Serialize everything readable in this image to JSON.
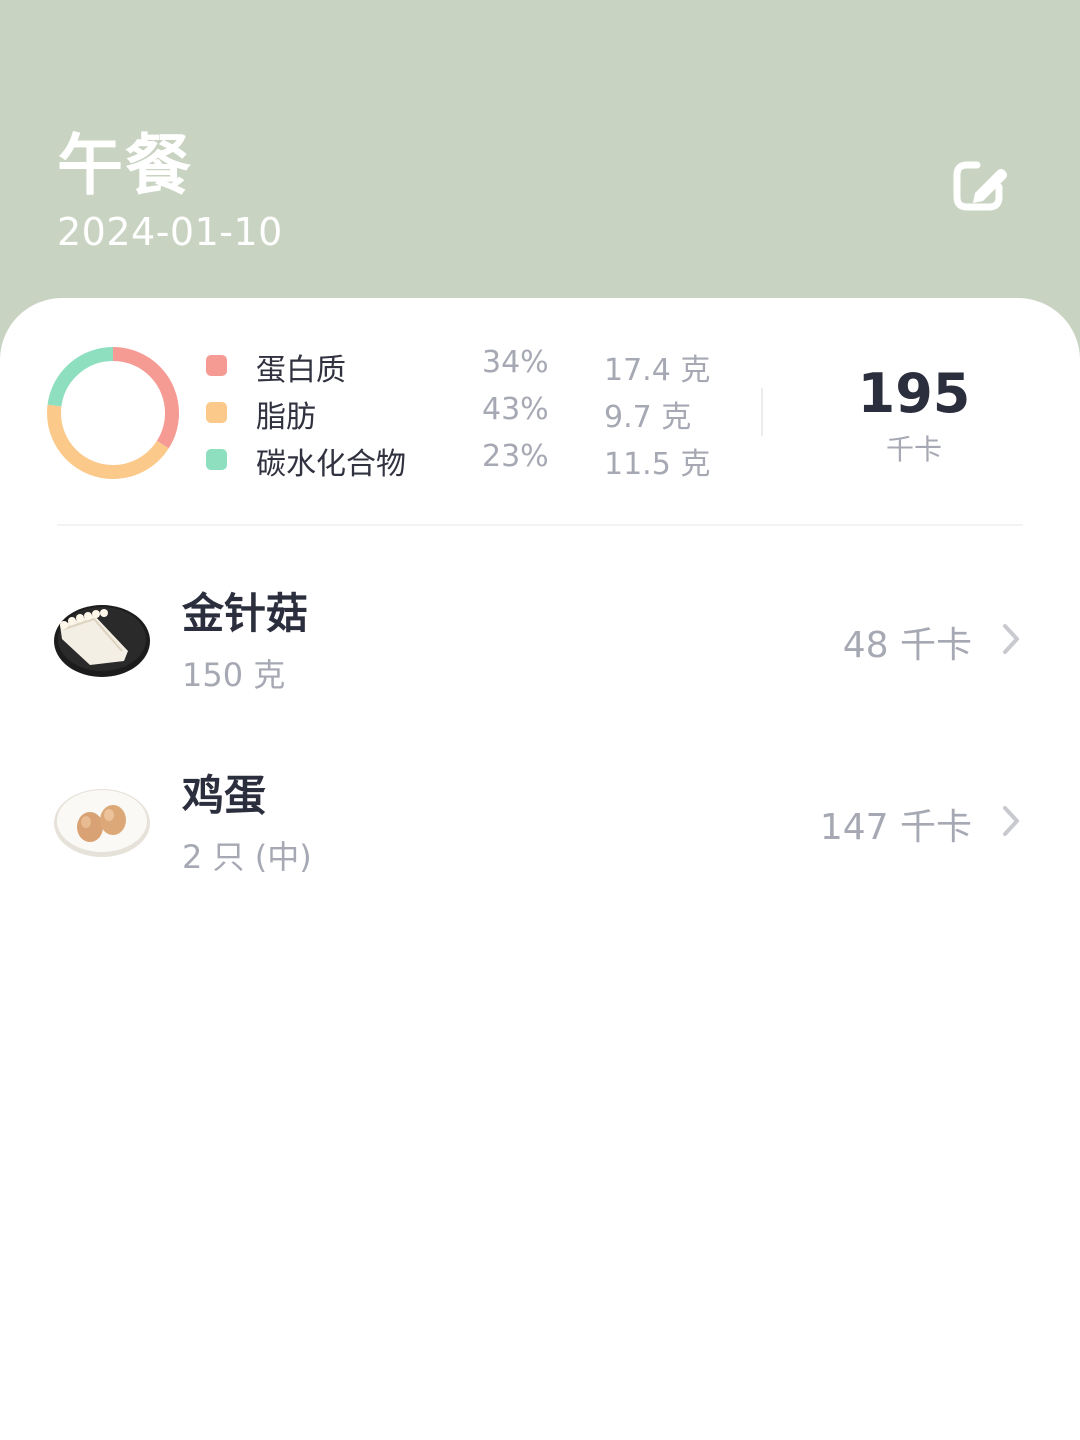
{
  "header": {
    "title": "午餐",
    "date": "2024-01-10",
    "edit_icon": "edit-icon",
    "background_color": "#c9d3c2"
  },
  "summary": {
    "macros": [
      {
        "name": "蛋白质",
        "percent": "34%",
        "amount": "17.4 克",
        "color": "#f59b93",
        "fraction": 0.34
      },
      {
        "name": "脂肪",
        "percent": "43%",
        "amount": "9.7 克",
        "color": "#fbc98a",
        "fraction": 0.43
      },
      {
        "name": "碳水化合物",
        "percent": "23%",
        "amount": "11.5 克",
        "color": "#8ddfc0",
        "fraction": 0.23
      }
    ],
    "total_kcal": "195",
    "total_unit": "千卡"
  },
  "foods": [
    {
      "name": "金针菇",
      "quantity": "150 克",
      "kcal": "48 千卡",
      "thumb_icon": "enoki-mushroom-icon"
    },
    {
      "name": "鸡蛋",
      "quantity": "2 只 (中)",
      "kcal": "147 千卡",
      "thumb_icon": "eggs-icon"
    }
  ]
}
